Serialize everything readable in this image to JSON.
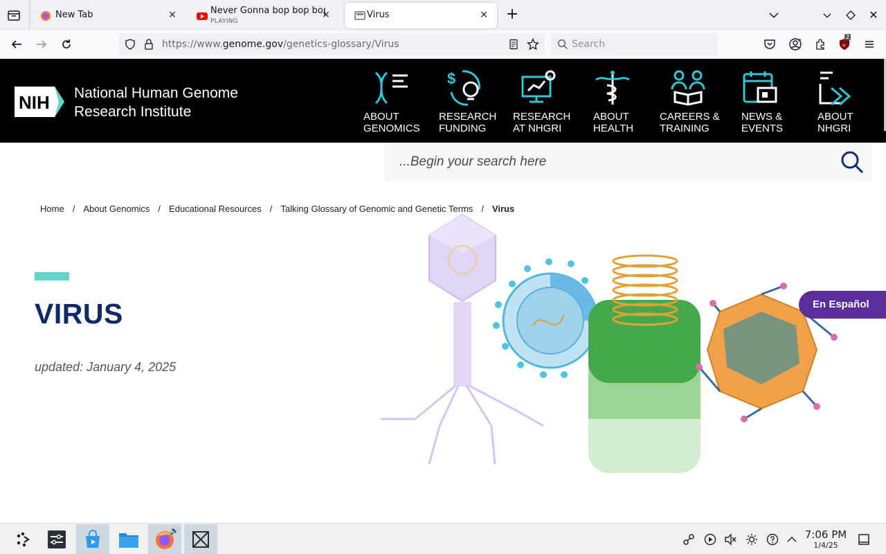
{
  "browser": {
    "tabs": [
      {
        "title": "New Tab",
        "sub": ""
      },
      {
        "title": "Never Gonna bop bop bop",
        "sub": "PLAYING"
      },
      {
        "title": "Virus",
        "sub": ""
      }
    ],
    "url": {
      "prefix": "https://www.",
      "domain": "genome.gov",
      "path": "/genetics-glossary/Virus"
    },
    "search_placeholder": "Search",
    "extension_badge": "2"
  },
  "site": {
    "logo_text": "NIH",
    "name_line1": "National Human Genome",
    "name_line2": "Research Institute",
    "menu": [
      {
        "label": "ABOUT\nGENOMICS",
        "icon": "dna-icon"
      },
      {
        "label": "RESEARCH\nFUNDING",
        "icon": "funding-lightbulb-icon"
      },
      {
        "label": "RESEARCH\nAT NHGRI",
        "icon": "research-monitor-icon"
      },
      {
        "label": "ABOUT\nHEALTH",
        "icon": "caduceus-icon"
      },
      {
        "label": "CAREERS &\nTRAINING",
        "icon": "people-book-icon"
      },
      {
        "label": "NEWS &\nEVENTS",
        "icon": "calendar-icon"
      },
      {
        "label": "ABOUT\nNHGRI",
        "icon": "nhgri-arrow-icon"
      }
    ],
    "search_placeholder": "...Begin your search here"
  },
  "breadcrumb": [
    "Home",
    "About Genomics",
    "Educational Resources",
    "Talking Glossary of Genomic and Genetic Terms",
    "Virus"
  ],
  "breadcrumb_sep": "/",
  "page": {
    "title": "VIRUS",
    "updated": "updated: January 4, 2025",
    "language_button": "En Español"
  },
  "taskbar": {
    "time": "7:06 PM",
    "date": "1/4/25"
  },
  "colors": {
    "header_bg": "#000000",
    "title": "#0e2a6b",
    "accent": "#5ed6c8",
    "espanol_bg": "#5b2d9a",
    "icon_teal": "#32c5d6"
  }
}
